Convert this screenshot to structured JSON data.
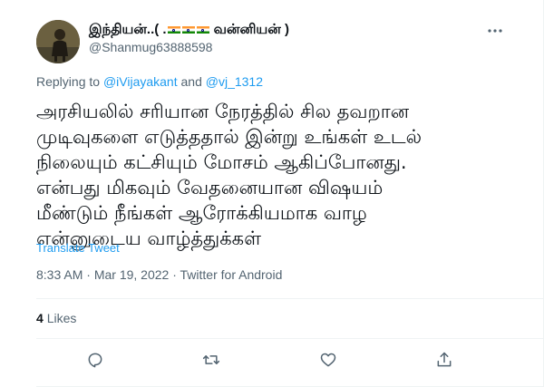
{
  "author": {
    "display_name_prefix": "இந்தியன்..( .",
    "display_name_suffix": "வன்னியன் )",
    "handle": "@Shanmug63888598"
  },
  "reply": {
    "prefix": "Replying to",
    "mention_1": "@iVijayakant",
    "conjunction": "and",
    "mention_2": "@vj_1312"
  },
  "tweet": {
    "text": "அரசியலில் சரியான நேரத்தில் சில தவறான\nமுடிவுகளை எடுத்ததால் இன்று உங்கள் உடல்\nநிலையும் கட்சியும் மோசம் ஆகிப்போனது.\nஎன்பது மிகவும் வேதனையான விஷயம்\nமீண்டும் நீங்கள் ஆரோக்கியமாக வாழ\nஎன்னுடைய வாழ்த்துக்கள்",
    "translate_label": "Translate Tweet",
    "time": "8:33 AM",
    "date": "Mar 19, 2022",
    "source": "Twitter for Android",
    "separator": "·"
  },
  "stats": {
    "likes_count": "4",
    "likes_label": "Likes"
  },
  "icons": {
    "more": "more-icon",
    "reply": "reply-icon",
    "retweet": "retweet-icon",
    "like": "heart-icon",
    "share": "share-icon"
  },
  "colors": {
    "link": "#1d9bf0",
    "secondary_text": "#536471",
    "primary_text": "#0f1419",
    "divider": "#eff3f4"
  }
}
